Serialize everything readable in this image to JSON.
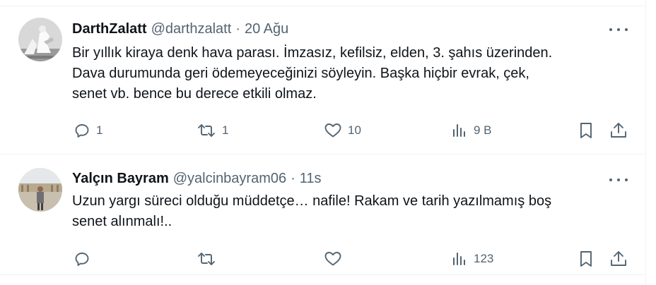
{
  "tweets": [
    {
      "author_name": "DarthZalatt",
      "handle": "@darthzalatt",
      "separator": "·",
      "time": "20 Ağu",
      "text_lines": [
        "Bir yıllık kiraya denk hava parası. İmzasız, kefilsiz, elden, 3. şahıs üzerinden.",
        "Dava durumunda geri ödemeyeceğinizi söyleyin. Başka hiçbir evrak, çek,",
        "senet vb. bence bu derece etkili olmaz."
      ],
      "replies": "1",
      "reposts": "1",
      "likes": "10",
      "views": "9 B"
    },
    {
      "author_name": "Yalçın Bayram",
      "handle": "@yalcinbayram06",
      "separator": "·",
      "time": "11s",
      "text_lines": [
        "Uzun yargı süreci olduğu müddetçe… nafile! Rakam ve tarih yazılmamış boş",
        "senet alınmalı!.."
      ],
      "replies": "",
      "reposts": "",
      "likes": "",
      "views": "123"
    }
  ],
  "icons": {
    "reply": "reply-icon",
    "repost": "repost-icon",
    "like": "heart-icon",
    "views": "views-chart-icon",
    "bookmark": "bookmark-icon",
    "share": "share-icon",
    "more": "more-options-icon"
  },
  "colors": {
    "text_primary": "#0f1419",
    "text_secondary": "#536471",
    "divider": "#eff3f4"
  }
}
